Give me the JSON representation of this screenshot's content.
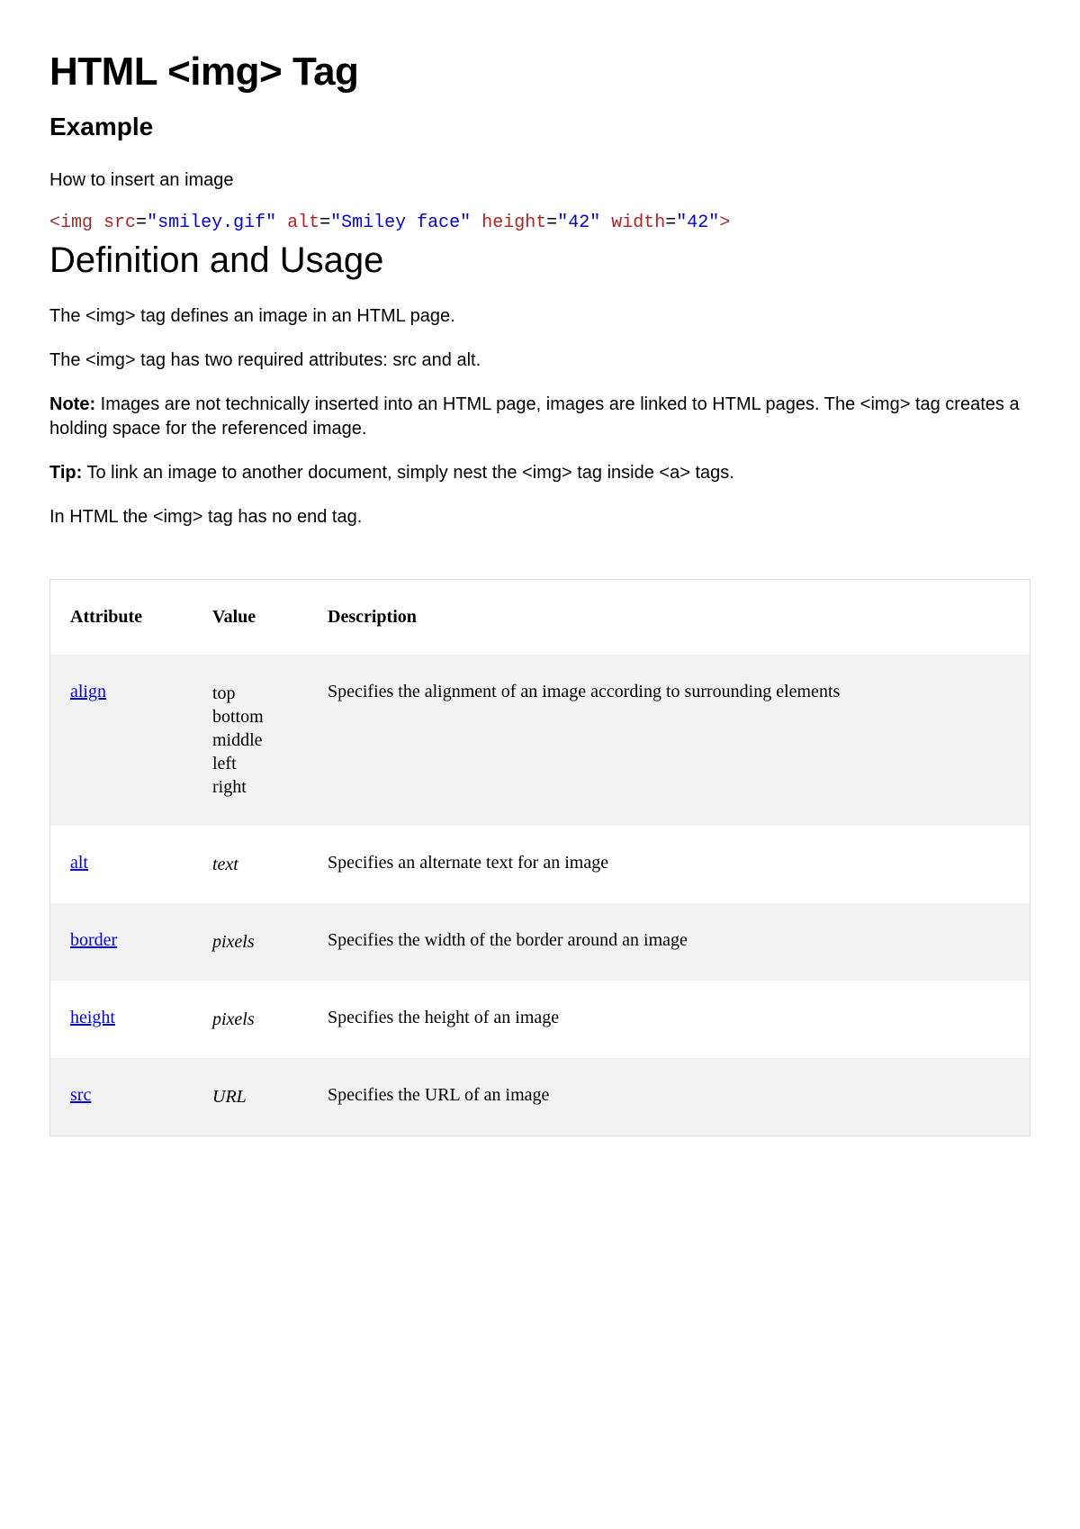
{
  "title": "HTML <img> Tag",
  "example": {
    "heading": "Example",
    "intro": "How to insert an image",
    "code": {
      "open": "<",
      "tag": "img",
      "attrs": [
        {
          "name": "src",
          "value": "\"smiley.gif\""
        },
        {
          "name": "alt",
          "value": "\"Smiley face\""
        },
        {
          "name": "height",
          "value": "\"42\""
        },
        {
          "name": "width",
          "value": "\"42\""
        }
      ],
      "close": ">"
    }
  },
  "definition": {
    "heading": "Definition and Usage",
    "p1": "The <img> tag defines an image in an HTML page.",
    "p2": "The <img> tag has two required attributes: src and alt.",
    "note_label": "Note:",
    "note_text": " Images are not technically inserted into an HTML page, images are linked to HTML pages. The <img> tag creates a holding space for the referenced image.",
    "tip_label": "Tip:",
    "tip_text": " To link an image to another document, simply nest the <img> tag inside <a> tags.",
    "p5": "In HTML the <img> tag has no end tag."
  },
  "table": {
    "headers": {
      "attr": "Attribute",
      "val": "Value",
      "desc": "Description"
    },
    "rows": [
      {
        "attr": "align",
        "value": "top\nbottom\nmiddle\nleft\nright",
        "value_italic": false,
        "desc": "Specifies the alignment of an image according to surrounding elements"
      },
      {
        "attr": "alt",
        "value": "text",
        "value_italic": true,
        "desc": "Specifies an alternate text for an image"
      },
      {
        "attr": "border",
        "value": "pixels",
        "value_italic": true,
        "desc": "Specifies the width of the border around an image"
      },
      {
        "attr": "height",
        "value": "pixels",
        "value_italic": true,
        "desc": "Specifies the height of an image"
      },
      {
        "attr": "src",
        "value": "URL",
        "value_italic": true,
        "desc": "Specifies the URL of an image"
      }
    ]
  }
}
